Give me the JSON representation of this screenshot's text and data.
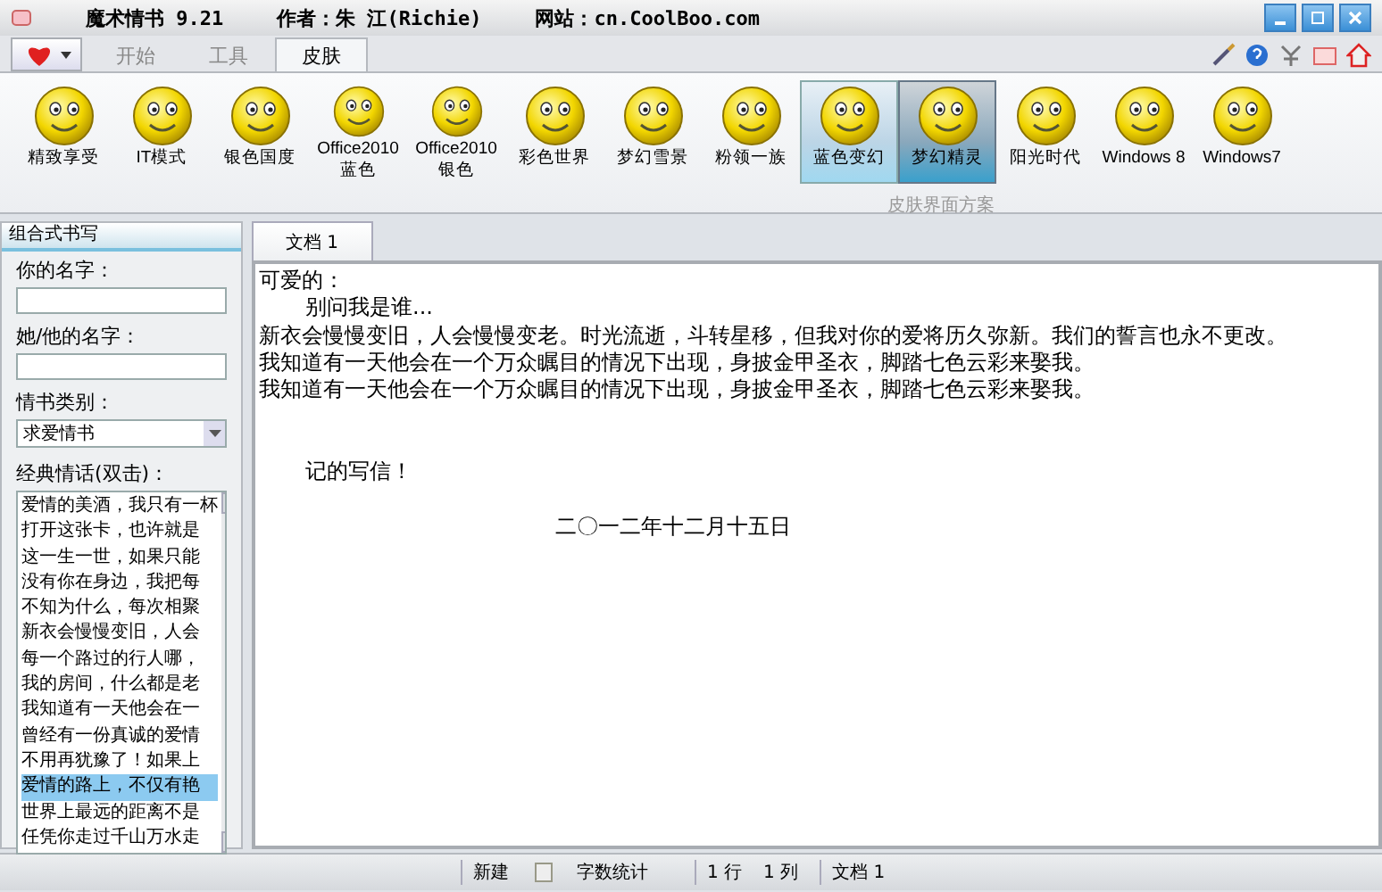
{
  "window": {
    "title": "魔术情书 9.21",
    "author": "作者：朱 江(Richie)",
    "website": "网站：cn.CoolBoo.com"
  },
  "ribbon_tabs": [
    {
      "label": "开始",
      "selected": false
    },
    {
      "label": "工具",
      "selected": false
    },
    {
      "label": "皮肤",
      "selected": true
    }
  ],
  "skins": [
    {
      "label": [
        "精致享受"
      ],
      "selected": false,
      "hovered": false
    },
    {
      "label": [
        "IT模式"
      ],
      "selected": false,
      "hovered": false
    },
    {
      "label": [
        "银色国度"
      ],
      "selected": false,
      "hovered": false
    },
    {
      "label": [
        "Office2010",
        "蓝色"
      ],
      "selected": false,
      "hovered": false
    },
    {
      "label": [
        "Office2010",
        "银色"
      ],
      "selected": false,
      "hovered": false
    },
    {
      "label": [
        "彩色世界"
      ],
      "selected": false,
      "hovered": false
    },
    {
      "label": [
        "梦幻雪景"
      ],
      "selected": false,
      "hovered": false
    },
    {
      "label": [
        "粉领一族"
      ],
      "selected": false,
      "hovered": false
    },
    {
      "label": [
        "蓝色变幻"
      ],
      "selected": false,
      "hovered": true
    },
    {
      "label": [
        "梦幻精灵"
      ],
      "selected": true,
      "hovered": false
    },
    {
      "label": [
        "阳光时代"
      ],
      "selected": false,
      "hovered": false
    },
    {
      "label": [
        "Windows 8"
      ],
      "selected": false,
      "hovered": false
    },
    {
      "label": [
        "Windows7"
      ],
      "selected": false,
      "hovered": false
    }
  ],
  "ribbon_group": "皮肤界面方案",
  "sidebar": {
    "title": "组合式书写",
    "your_name_label": "你的名字：",
    "their_name_label": "她/他的名字：",
    "category_label": "情书类别：",
    "category_value": "求爱情书",
    "phrases_label": "经典情话(双击)：",
    "phrases": [
      {
        "text": "爱情的美酒，我只有一杯",
        "selected": false
      },
      {
        "text": "打开这张卡，也许就是",
        "selected": false
      },
      {
        "text": "这一生一世，如果只能",
        "selected": false
      },
      {
        "text": "没有你在身边，我把每",
        "selected": false
      },
      {
        "text": "不知为什么，每次相聚",
        "selected": false
      },
      {
        "text": "新衣会慢慢变旧，人会",
        "selected": false
      },
      {
        "text": "每一个路过的行人哪，",
        "selected": false
      },
      {
        "text": "我的房间，什么都是老",
        "selected": false
      },
      {
        "text": "我知道有一天他会在一",
        "selected": false
      },
      {
        "text": "曾经有一份真诚的爱情",
        "selected": false
      },
      {
        "text": "不用再犹豫了！如果上",
        "selected": false
      },
      {
        "text": "爱情的路上，不仅有艳",
        "selected": true
      },
      {
        "text": "世界上最远的距离不是",
        "selected": false
      },
      {
        "text": "任凭你走过千山万水走",
        "selected": false
      }
    ]
  },
  "document_tabs": [
    {
      "label": "文档 1",
      "selected": true
    }
  ],
  "document_lines": [
    {
      "text": "可爱的：",
      "kind": "plain"
    },
    {
      "text": "别问我是谁...",
      "kind": "indent"
    },
    {
      "text": "新衣会慢慢变旧，人会慢慢变老。时光流逝，斗转星移，但我对你的爱将历久弥新。我们的誓言也永不更改。",
      "kind": "plain"
    },
    {
      "text": "我知道有一天他会在一个万众瞩目的情况下出现，身披金甲圣衣，脚踏七色云彩来娶我。",
      "kind": "plain"
    },
    {
      "text": "我知道有一天他会在一个万众瞩目的情况下出现，身披金甲圣衣，脚踏七色云彩来娶我。",
      "kind": "plain"
    },
    {
      "kind": "blank"
    },
    {
      "kind": "blank"
    },
    {
      "text": "记的写信！",
      "kind": "indent"
    },
    {
      "kind": "blank"
    },
    {
      "text": "二〇一二年十二月十五日",
      "kind": "center"
    }
  ],
  "status_bar": {
    "new": "新建",
    "word_count": "字数统计",
    "row": "1 行",
    "column": "1 列",
    "document": "文档 1"
  }
}
